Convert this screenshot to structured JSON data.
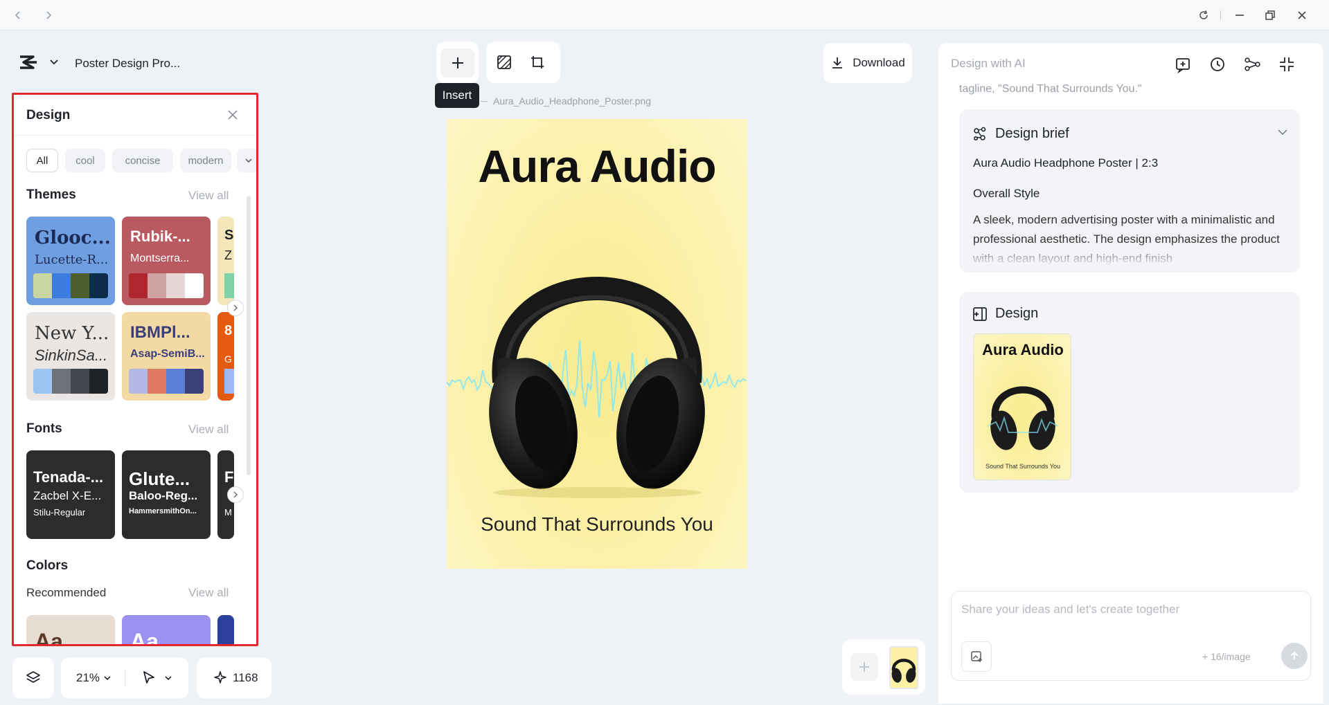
{
  "window": {
    "controls": [
      "back",
      "forward",
      "reload",
      "minimize",
      "restore",
      "close"
    ]
  },
  "project": {
    "title": "Poster Design Pro..."
  },
  "design_panel": {
    "title": "Design",
    "filters": [
      "All",
      "cool",
      "concise",
      "modern"
    ],
    "themes": {
      "title": "Themes",
      "view_all": "View all",
      "items": [
        {
          "title": "Glooc...",
          "subtitle": "Lucette-R...",
          "bg": "#6f9fe0",
          "text": "#1b2a55",
          "swatches": [
            "#c9d6a3",
            "#3d7de0",
            "#4b5e2c",
            "#0d2e4a"
          ]
        },
        {
          "title": "Rubik-...",
          "subtitle": "Montserra...",
          "bg": "#b85a5f",
          "text": "#ffffff",
          "swatches": [
            "#b0252e",
            "#cfa2a4",
            "#e6d6d6",
            "#ffffff"
          ]
        },
        {
          "title": "New Y...",
          "subtitle": "SinkinSa...",
          "bg": "#e9e6e3",
          "text": "#333333",
          "swatches": [
            "#9cc4f0",
            "#6d7278",
            "#42474d",
            "#1f2226"
          ]
        },
        {
          "title": "IBMPl...",
          "subtitle": "Asap-SemiB...",
          "bg": "#f3d9a4",
          "text": "#3a3f7a",
          "swatches": [
            "#b3b8e6",
            "#e07b63",
            "#5b7fd6",
            "#3a3f7a"
          ]
        }
      ],
      "partial": [
        {
          "title": "S",
          "subtitle": "Z"
        },
        {
          "title": "8",
          "subtitle": "G"
        }
      ]
    },
    "fonts": {
      "title": "Fonts",
      "view_all": "View all",
      "items": [
        {
          "line1": "Tenada-...",
          "line2": "Zacbel X-E...",
          "line3": "Stilu-Regular"
        },
        {
          "line1": "Glute...",
          "line2": "Baloo-Reg...",
          "line3": "HammersmithOn..."
        }
      ],
      "partial": {
        "line1": "F",
        "line3": "M"
      }
    },
    "colors": {
      "title": "Colors",
      "subtitle": "Recommended",
      "view_all": "View all",
      "items": [
        {
          "label": "Aa",
          "bg": "#e8ddd3",
          "text": "#5a3a2a"
        },
        {
          "label": "Aa",
          "bg": "#9b8ff0",
          "text": "#ffffff"
        }
      ]
    }
  },
  "bottom_toolbar": {
    "zoom": "21%",
    "credits": "1168"
  },
  "canvas": {
    "insert_tooltip": "Insert",
    "filename": "Aura_Audio_Headphone_Poster.png",
    "poster": {
      "title": "Aura Audio",
      "tagline": "Sound That Surrounds You"
    }
  },
  "download": {
    "label": "Download"
  },
  "ai_panel": {
    "title": "Design with AI",
    "clipped_text": "tagline, \"Sound That Surrounds You.\"",
    "brief": {
      "title": "Design brief",
      "headline": "Aura Audio Headphone Poster | 2:3",
      "style_label": "Overall Style",
      "style_text": "A sleek, modern advertising poster with a minimalistic and professional aesthetic. The design emphasizes the product with a clean layout and high-end finish"
    },
    "design": {
      "title": "Design",
      "thumb_title": "Aura Audio",
      "thumb_tagline": "Sound That Surrounds You"
    },
    "chat": {
      "placeholder": "Share your ideas and let's create together",
      "cost": "+ 16/image"
    }
  },
  "colors": {
    "accent_border": "#e5262d",
    "poster_yellow": "#fbf0a4"
  }
}
